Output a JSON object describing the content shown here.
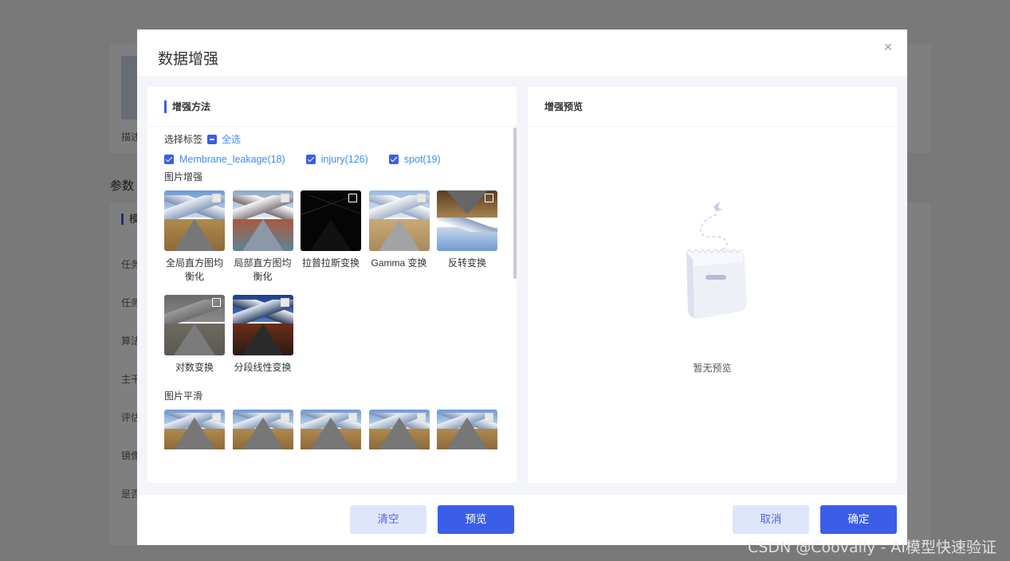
{
  "background": {
    "desc_label": "描述",
    "section_title": "参数",
    "card_header": "模",
    "rows": [
      "任务",
      "任务",
      "算法",
      "主干",
      "评估",
      "镜像",
      "是否"
    ]
  },
  "modal": {
    "title": "数据增强",
    "close_icon": "close-icon",
    "left_panel": {
      "title": "增强方法",
      "select_label": "选择标签",
      "select_all": "全选",
      "tags": [
        {
          "label": "Membrane_leakage(18)",
          "checked": true
        },
        {
          "label": "injury(126)",
          "checked": true
        },
        {
          "label": "spot(19)",
          "checked": true
        }
      ],
      "image_enhance_label": "图片增强",
      "image_enhance_items": [
        {
          "label": "全局直方图均衡化",
          "style": "t-local",
          "check": "light"
        },
        {
          "label": "局部直方图均衡化",
          "style": "t-local",
          "check": "light"
        },
        {
          "label": "拉普拉斯变换",
          "style": "t-laplace",
          "check": "dark"
        },
        {
          "label": "Gamma 变换",
          "style": "t-gamma",
          "check": "light"
        },
        {
          "label": "反转变换",
          "style": "t-flip",
          "check": "dark"
        },
        {
          "label": "对数变换",
          "style": "t-log",
          "check": "dark"
        },
        {
          "label": "分段线性变换",
          "style": "t-piece",
          "check": "light"
        }
      ],
      "image_smooth_label": "图片平滑",
      "image_smooth_count": 5
    },
    "right_panel": {
      "title": "增强预览",
      "empty_text": "暂无预览",
      "empty_icon": "empty-bag-icon"
    },
    "footer": {
      "clear": "清空",
      "preview": "预览",
      "cancel": "取消",
      "confirm": "确定"
    }
  },
  "colors": {
    "primary": "#3b5ee8",
    "primary_light": "#dfe5fb",
    "link": "#3b8cf0"
  },
  "watermark": "CSDN @Coovally - AI模型快速验证"
}
